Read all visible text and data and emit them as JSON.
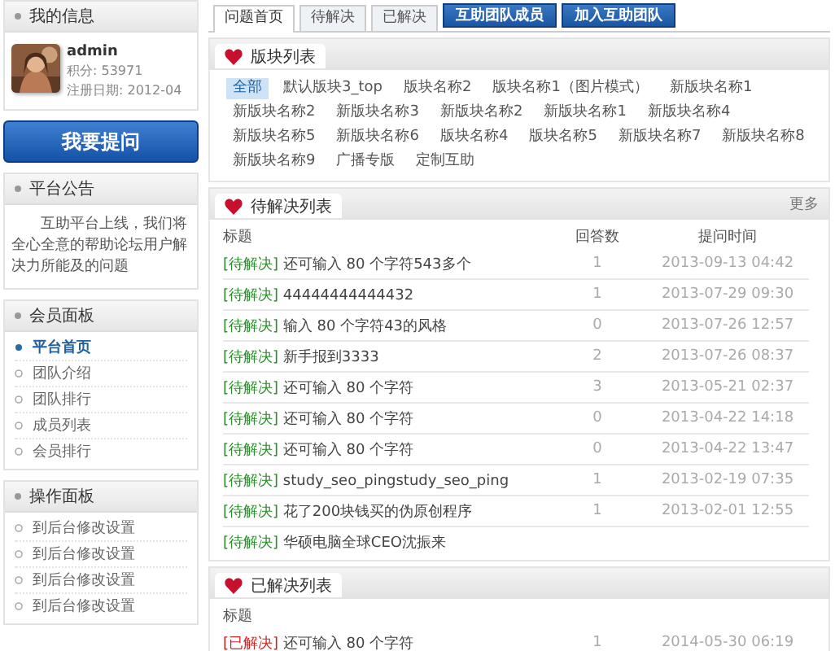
{
  "sidebar": {
    "profile": {
      "title": "我的信息",
      "username": "admin",
      "points": "积分: 53971",
      "registered": "注册日期: 2012-04"
    },
    "ask_button": "我要提问",
    "notice": {
      "title": "平台公告",
      "text": "互助平台上线，我们将全心全意的帮助论坛用户解决力所能及的问题"
    },
    "member_panel": {
      "title": "会员面板",
      "items": [
        {
          "label": "平台首页",
          "selected": true
        },
        {
          "label": "团队介绍",
          "selected": false
        },
        {
          "label": "团队排行",
          "selected": false
        },
        {
          "label": "成员列表",
          "selected": false
        },
        {
          "label": "会员排行",
          "selected": false
        }
      ]
    },
    "operation_panel": {
      "title": "操作面板",
      "items": [
        {
          "label": "到后台修改设置",
          "selected": false
        },
        {
          "label": "到后台修改设置",
          "selected": false
        },
        {
          "label": "到后台修改设置",
          "selected": false
        },
        {
          "label": "到后台修改设置",
          "selected": false
        }
      ]
    }
  },
  "tabs": [
    {
      "label": "问题首页",
      "kind": "tab",
      "selected": true
    },
    {
      "label": "待解决",
      "kind": "tab",
      "selected": false
    },
    {
      "label": "已解决",
      "kind": "tab",
      "selected": false
    },
    {
      "label": "互助团队成员",
      "kind": "button"
    },
    {
      "label": "加入互助团队",
      "kind": "button"
    }
  ],
  "boards": {
    "title": "版块列表",
    "tags": [
      {
        "label": "全部",
        "selected": true
      },
      {
        "label": "默认版块3_top",
        "selected": false
      },
      {
        "label": "版块名称2",
        "selected": false
      },
      {
        "label": "版块名称1（图片模式）",
        "selected": false
      },
      {
        "label": "新版块名称1",
        "selected": false
      },
      {
        "label": "新版块名称2",
        "selected": false
      },
      {
        "label": "新版块名称3",
        "selected": false
      },
      {
        "label": "新版块名称2",
        "selected": false
      },
      {
        "label": "新版块名称1",
        "selected": false
      },
      {
        "label": "新版块名称4",
        "selected": false
      },
      {
        "label": "新版块名称5",
        "selected": false
      },
      {
        "label": "新版块名称6",
        "selected": false
      },
      {
        "label": "版块名称4",
        "selected": false
      },
      {
        "label": "版块名称5",
        "selected": false
      },
      {
        "label": "新版块名称7",
        "selected": false
      },
      {
        "label": "新版块名称8",
        "selected": false
      },
      {
        "label": "新版块名称9",
        "selected": false
      },
      {
        "label": "广播专版",
        "selected": false
      },
      {
        "label": "定制互助",
        "selected": false
      }
    ]
  },
  "pending": {
    "title": "待解决列表",
    "more": "更多",
    "columns": [
      "标题",
      "回答数",
      "提问时间"
    ],
    "rows": [
      {
        "kind": "pending",
        "status": "[待解决]",
        "title": "还可输入 80 个字符543多个",
        "answers": "1",
        "time": "2013-09-13 04:42"
      },
      {
        "kind": "pending",
        "status": "[待解决]",
        "title": "44444444444432",
        "answers": "1",
        "time": "2013-07-29 09:30"
      },
      {
        "kind": "pending",
        "status": "[待解决]",
        "title": "输入 80 个字符43的风格",
        "answers": "0",
        "time": "2013-07-26 12:57"
      },
      {
        "kind": "pending",
        "status": "[待解决]",
        "title": "新手报到3333",
        "answers": "2",
        "time": "2013-07-26 08:37"
      },
      {
        "kind": "pending",
        "status": "[待解决]",
        "title": "还可输入 80 个字符",
        "answers": "3",
        "time": "2013-05-21 02:37"
      },
      {
        "kind": "pending",
        "status": "[待解决]",
        "title": "还可输入 80 个字符",
        "answers": "0",
        "time": "2013-04-22 14:18"
      },
      {
        "kind": "pending",
        "status": "[待解决]",
        "title": "还可输入 80 个字符",
        "answers": "0",
        "time": "2013-04-22 13:47"
      },
      {
        "kind": "pending",
        "status": "[待解决]",
        "title": "study_seo_pingstudy_seo_ping",
        "answers": "1",
        "time": "2013-02-19 07:35"
      },
      {
        "kind": "pending",
        "status": "[待解决]",
        "title": "花了200块钱买的伪原创程序",
        "answers": "1",
        "time": "2013-02-01 12:55"
      },
      {
        "kind": "pending",
        "status": "[待解决]",
        "title": "华硕电脑全球CEO沈振来"
      }
    ]
  },
  "solved": {
    "title": "已解决列表",
    "columns": [
      "标题"
    ],
    "rows": [
      {
        "kind": "solved",
        "status": "[已解决]",
        "title": "还可输入 80 个字符",
        "answers": "1",
        "time": "2014-05-30 06:19"
      }
    ]
  }
}
